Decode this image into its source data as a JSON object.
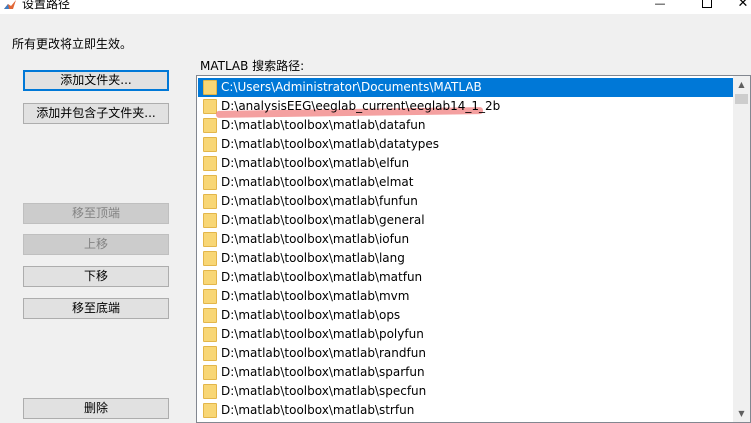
{
  "window": {
    "title": "设置路径",
    "minimize_glyph": "—",
    "close_glyph": "✕"
  },
  "notice": "所有更改将立即生效。",
  "buttons": {
    "add_folder": "添加文件夹...",
    "add_with_subfolders": "添加并包含子文件夹...",
    "move_to_top": "移至顶端",
    "move_up": "上移",
    "move_down": "下移",
    "move_to_bottom": "移至底端",
    "remove": "删除"
  },
  "path_label": "MATLAB 搜索路径:",
  "paths": [
    "C:\\Users\\Administrator\\Documents\\MATLAB",
    "D:\\analysisEEG\\eeglab_current\\eeglab14_1_2b",
    "D:\\matlab\\toolbox\\matlab\\datafun",
    "D:\\matlab\\toolbox\\matlab\\datatypes",
    "D:\\matlab\\toolbox\\matlab\\elfun",
    "D:\\matlab\\toolbox\\matlab\\elmat",
    "D:\\matlab\\toolbox\\matlab\\funfun",
    "D:\\matlab\\toolbox\\matlab\\general",
    "D:\\matlab\\toolbox\\matlab\\iofun",
    "D:\\matlab\\toolbox\\matlab\\lang",
    "D:\\matlab\\toolbox\\matlab\\matfun",
    "D:\\matlab\\toolbox\\matlab\\mvm",
    "D:\\matlab\\toolbox\\matlab\\ops",
    "D:\\matlab\\toolbox\\matlab\\polyfun",
    "D:\\matlab\\toolbox\\matlab\\randfun",
    "D:\\matlab\\toolbox\\matlab\\sparfun",
    "D:\\matlab\\toolbox\\matlab\\specfun",
    "D:\\matlab\\toolbox\\matlab\\strfun"
  ],
  "selected_index": 0,
  "highlighted_index": 1,
  "colors": {
    "selection": "#0078d7",
    "highlight_marker": "#f08080",
    "folder": "#f8d675"
  },
  "icons": {
    "folder": "folder-icon",
    "app": "matlab-logo-icon"
  }
}
